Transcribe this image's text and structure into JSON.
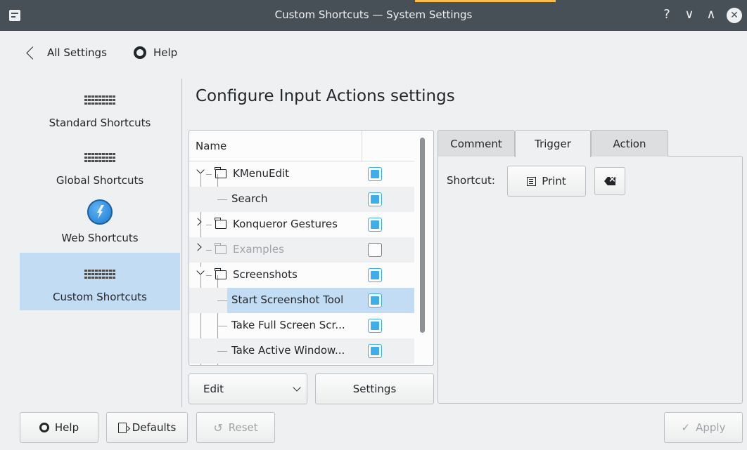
{
  "window": {
    "title": "Custom Shortcuts — System Settings",
    "help_glyph": "?",
    "minimize_glyph": "∨",
    "maximize_glyph": "∧",
    "close_glyph": "✕"
  },
  "toolbar": {
    "all_settings_label": "All Settings",
    "help_label": "Help"
  },
  "sidebar": {
    "items": [
      {
        "label": "Standard Shortcuts",
        "icon": "keyboard-icon",
        "selected": false
      },
      {
        "label": "Global Shortcuts",
        "icon": "keyboard-icon",
        "selected": false
      },
      {
        "label": "Web Shortcuts",
        "icon": "globe-icon",
        "selected": false
      },
      {
        "label": "Custom Shortcuts",
        "icon": "keyboard-icon",
        "selected": true
      }
    ]
  },
  "main": {
    "title": "Configure Input Actions settings",
    "tree": {
      "column_name": "Name",
      "rows": [
        {
          "label": "KMenuEdit",
          "type": "group",
          "expander": "open",
          "enabled": true
        },
        {
          "label": "Search",
          "type": "item",
          "enabled": true
        },
        {
          "label": "Konqueror Gestures",
          "type": "group",
          "expander": "closed",
          "enabled": true
        },
        {
          "label": "Examples",
          "type": "group",
          "expander": "closed",
          "enabled": false
        },
        {
          "label": "Screenshots",
          "type": "group",
          "expander": "open",
          "enabled": true
        },
        {
          "label": "Start Screenshot Tool",
          "type": "item",
          "enabled": true,
          "selected": true
        },
        {
          "label": "Take Full Screen Scr...",
          "type": "item",
          "enabled": true
        },
        {
          "label": "Take Active Window...",
          "type": "item",
          "enabled": true
        }
      ]
    },
    "edit_button": "Edit",
    "settings_button": "Settings",
    "tabs": [
      {
        "label": "Comment",
        "active": false
      },
      {
        "label": "Trigger",
        "active": true
      },
      {
        "label": "Action",
        "active": false
      }
    ],
    "trigger": {
      "shortcut_label": "Shortcut:",
      "shortcut_value": "Print"
    }
  },
  "footer": {
    "help_button": "Help",
    "defaults_button": "Defaults",
    "reset_button": "Reset",
    "apply_button": "Apply",
    "reset_glyph": "↺",
    "apply_glyph": "✓"
  },
  "colors": {
    "titlebar": "#475057",
    "selection": "#c2dcf3",
    "checkbox_accent": "#3daee9",
    "window_bg": "#eff0f1"
  }
}
